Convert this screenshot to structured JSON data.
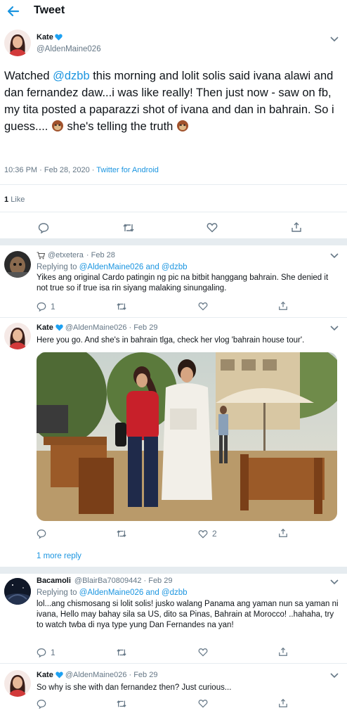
{
  "header": {
    "title": "Tweet"
  },
  "main_tweet": {
    "name": "Kate",
    "handle": "@AldenMaine026",
    "text_mention": "@dzbb",
    "text_pre": "Watched ",
    "text_post": " this morning and lolit solis said ivana alawi and dan fernandez daw...i was like really! Then just now - saw on fb, my tita posted a paparazzi shot of ivana and dan in bahrain. So i guess.... ",
    "text_end": " she's telling the truth ",
    "timestamp": "10:36 PM · Feb 28, 2020 · ",
    "client": "Twitter for Android",
    "likes_count": "1",
    "likes_label": "Like"
  },
  "replies": [
    {
      "name": "",
      "handle": "@etxetera",
      "date": "· Feb 28",
      "replying_prefix": "Replying to ",
      "replying_to": "@AldenMaine026 and @dzbb",
      "text": "Yikes ang original Cardo patingin ng pic na bitbit hanggang bahrain. She denied it not true so if true isa rin siyang malaking sinungaling.",
      "reply_count": "1"
    },
    {
      "name": "Kate",
      "handle": "@AldenMaine026",
      "date": "· Feb 29",
      "text": "Here you go. And she's in bahrain tlga, check her vlog 'bahrain house tour'.",
      "like_count": "2",
      "more_replies": "1 more reply"
    },
    {
      "name": "Bacamoli",
      "handle": "@BlairBa70809442",
      "date": "· Feb 29",
      "replying_prefix": "Replying to ",
      "replying_to": "@AldenMaine026 and @dzbb",
      "text": "lol...ang chismosang si lolit solis! jusko walang Panama ang yaman nun sa yaman ni ivana, Hello may bahay sila sa US, dito sa Pinas, Bahrain at Morocco! ..hahaha, try to watch twba di nya type yung Dan Fernandes na yan!",
      "reply_count": "1"
    },
    {
      "name": "Kate",
      "handle": "@AldenMaine026",
      "date": "· Feb 29",
      "text": "So why is she with dan fernandez then? Just curious..."
    }
  ],
  "colors": {
    "accent": "#1b95e0",
    "heart_blue": "#1da1f2",
    "divider": "#e6ecf0"
  },
  "icons": [
    "back-arrow-icon",
    "verified-heart-icon",
    "chevron-down-icon",
    "reply-icon",
    "retweet-icon",
    "like-icon",
    "share-icon",
    "monkey-emoji-icon",
    "shopping-cart-icon"
  ]
}
